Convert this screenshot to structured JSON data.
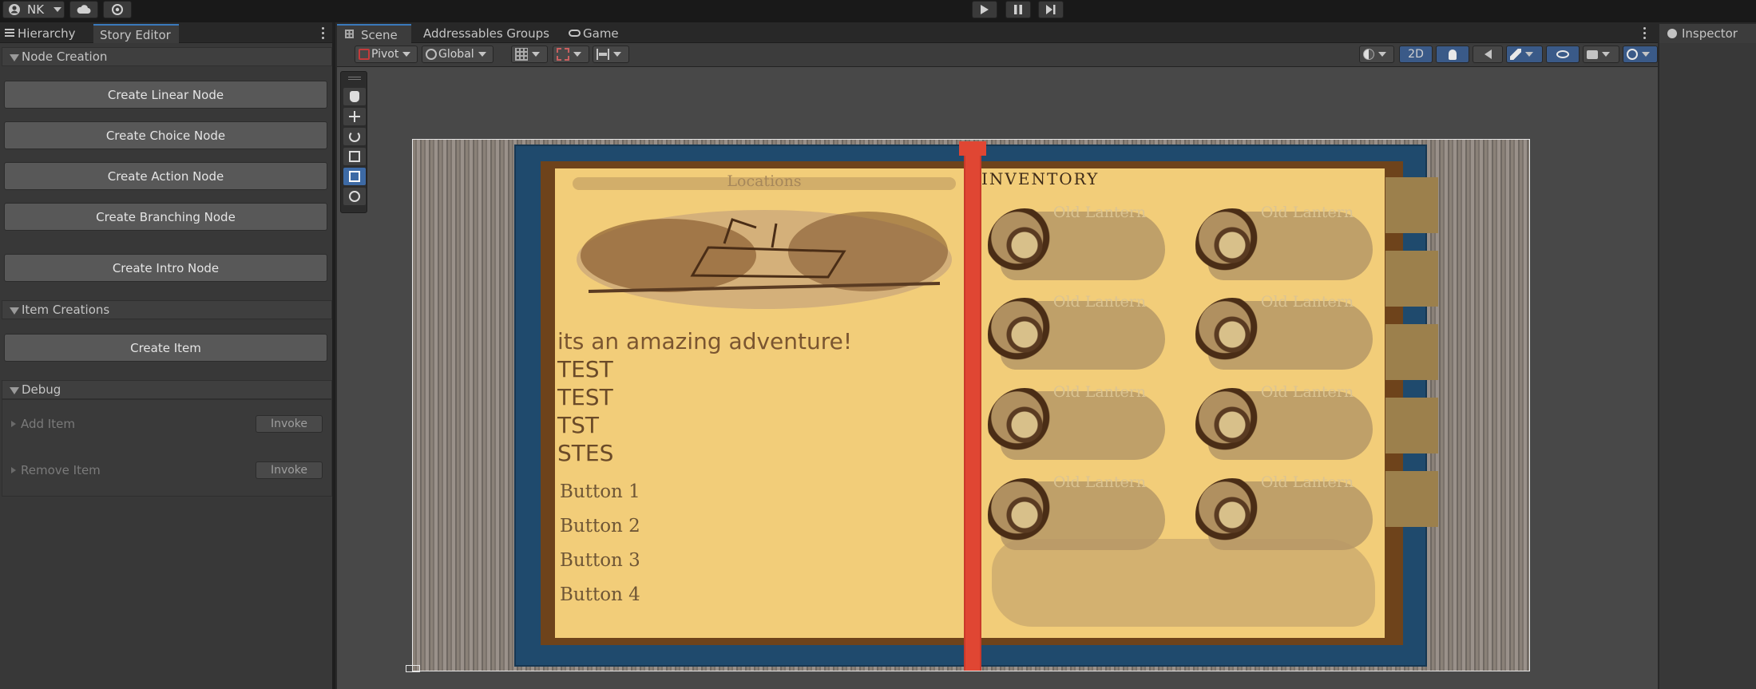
{
  "toolbar": {
    "account_label": "NK",
    "colors": {
      "bg": "#191919"
    }
  },
  "left_panel": {
    "tabs": [
      {
        "label": "Hierarchy",
        "active": false
      },
      {
        "label": "Story Editor",
        "active": true
      }
    ],
    "sections": {
      "node_creation": {
        "title": "Node Creation",
        "buttons": [
          "Create Linear Node",
          "Create Choice Node",
          "Create Action Node",
          "Create Branching Node",
          "Create Intro Node"
        ]
      },
      "item_creations": {
        "title": "Item Creations",
        "buttons": [
          "Create Item"
        ]
      },
      "debug": {
        "title": "Debug",
        "rows": [
          {
            "label": "Add Item",
            "button": "Invoke"
          },
          {
            "label": "Remove Item",
            "button": "Invoke"
          }
        ]
      }
    }
  },
  "scene_view": {
    "tabs": [
      {
        "label": "Scene",
        "active": true
      },
      {
        "label": "Addressables Groups",
        "active": false
      },
      {
        "label": "Game",
        "active": false
      }
    ],
    "toolbar": {
      "pivot": "Pivot",
      "space": "Global",
      "mode_2d": "2D"
    }
  },
  "inspector": {
    "tab": "Inspector"
  },
  "game": {
    "left_page": {
      "header": "Locations",
      "lines": [
        "its an amazing adventure!",
        "TEST",
        "TEST",
        "TST",
        "STES"
      ],
      "buttons": [
        "Button 1",
        "Button 2",
        "Button 3",
        "Button 4"
      ]
    },
    "right_page": {
      "header": "INVENTORY",
      "items": [
        "Old Lantern",
        "Old Lantern",
        "Old Lantern",
        "Old Lantern",
        "Old Lantern",
        "Old Lantern",
        "Old Lantern",
        "Old Lantern"
      ]
    },
    "colors": {
      "paper": "#f2cd79",
      "book_cover": "#1f4a6d",
      "inner_border": "#6e431b",
      "ribbon": "#e04633",
      "wood": "#8a8178"
    }
  }
}
